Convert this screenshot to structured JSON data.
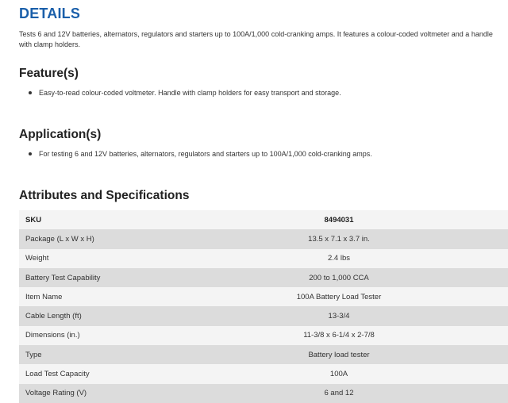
{
  "details": {
    "heading": "DETAILS",
    "description": "Tests 6 and 12V batteries, alternators, regulators and starters up to 100A/1,000 cold-cranking amps. It features a colour-coded voltmeter and a handle with clamp holders."
  },
  "features": {
    "heading": "Feature(s)",
    "items": [
      "Easy-to-read colour-coded voltmeter. Handle with clamp holders for easy transport and storage."
    ]
  },
  "applications": {
    "heading": "Application(s)",
    "items": [
      "For testing 6 and 12V batteries, alternators, regulators and starters up to 100A/1,000 cold-cranking amps."
    ]
  },
  "attributes": {
    "heading": "Attributes and Specifications",
    "rows": [
      {
        "label": "SKU",
        "value": "8494031"
      },
      {
        "label": "Package (L x W x H)",
        "value": "13.5 x 7.1 x 3.7 in."
      },
      {
        "label": "Weight",
        "value": "2.4 lbs"
      },
      {
        "label": "Battery Test Capability",
        "value": "200 to 1,000 CCA"
      },
      {
        "label": "Item Name",
        "value": "100A Battery Load Tester"
      },
      {
        "label": "Cable Length (ft)",
        "value": "13-3/4"
      },
      {
        "label": "Dimensions (in.)",
        "value": "11-3/8 x 6-1/4 x 2-7/8"
      },
      {
        "label": "Type",
        "value": "Battery load tester"
      },
      {
        "label": "Load Test Capacity",
        "value": "100A"
      },
      {
        "label": "Voltage Rating (V)",
        "value": "6 and 12"
      }
    ]
  },
  "colors": {
    "details_heading": "#1a5faa",
    "row_light": "#f4f4f4",
    "row_dark": "#dcdcdc"
  }
}
